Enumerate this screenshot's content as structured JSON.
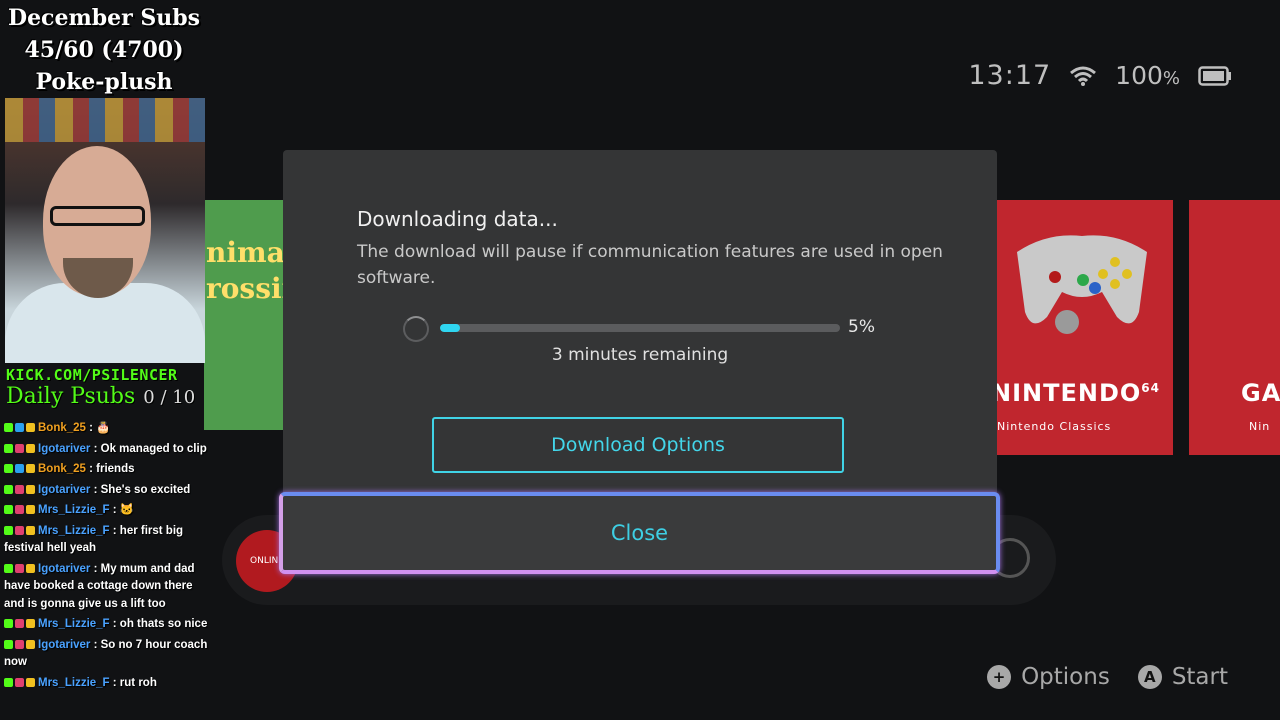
{
  "status": {
    "time": "13:17",
    "battery": "100",
    "battery_unit": "%"
  },
  "background_tiles": {
    "n64_brand": "NINTENDO",
    "n64_sup": "64",
    "n64_sub": "Nintendo Classics",
    "next_brand": "GA",
    "next_sub": "Nin",
    "ac_text": "nimal\nrossin",
    "online_label": "ONLINE"
  },
  "dialog": {
    "title": "Downloading data...",
    "description": "The download will pause if communication features are used in open software.",
    "progress_percent": 5,
    "progress_label": "5%",
    "remaining": "3 minutes remaining",
    "options_button": "Download Options",
    "close_button": "Close"
  },
  "footer": {
    "options": {
      "glyph": "+",
      "label": "Options"
    },
    "start": {
      "glyph": "A",
      "label": "Start"
    }
  },
  "overlay": {
    "line1": "December Subs",
    "line2": "45/60 (4700)",
    "line3": "Poke-plush",
    "kick": "KICK.COM/PSILENCER",
    "daily": "Daily Psubs",
    "daily_count": "0 / 10"
  },
  "chat": [
    {
      "user": "Bonk_25",
      "color": "orange",
      "text": ": 🎂"
    },
    {
      "user": "Igotariver",
      "color": "blue",
      "text": ": Ok managed to clip"
    },
    {
      "user": "Bonk_25",
      "color": "orange",
      "text": ": friends"
    },
    {
      "user": "Igotariver",
      "color": "blue",
      "text": ": She's so excited"
    },
    {
      "user": "Mrs_Lizzie_F",
      "color": "blue",
      "text": ": 🐱"
    },
    {
      "user": "Mrs_Lizzie_F",
      "color": "blue",
      "text": ": her first big festival hell yeah"
    },
    {
      "user": "Igotariver",
      "color": "blue",
      "text": ": My mum and dad have booked a cottage down there and is gonna give us a lift too"
    },
    {
      "user": "Mrs_Lizzie_F",
      "color": "blue",
      "text": ": oh thats so nice"
    },
    {
      "user": "Igotariver",
      "color": "blue",
      "text": ": So no 7 hour coach now"
    },
    {
      "user": "Mrs_Lizzie_F",
      "color": "blue",
      "text": ": rut roh"
    }
  ],
  "colors": {
    "accent": "#2fd5f0",
    "tile_red": "#c0262e",
    "kick_green": "#53fc18"
  }
}
